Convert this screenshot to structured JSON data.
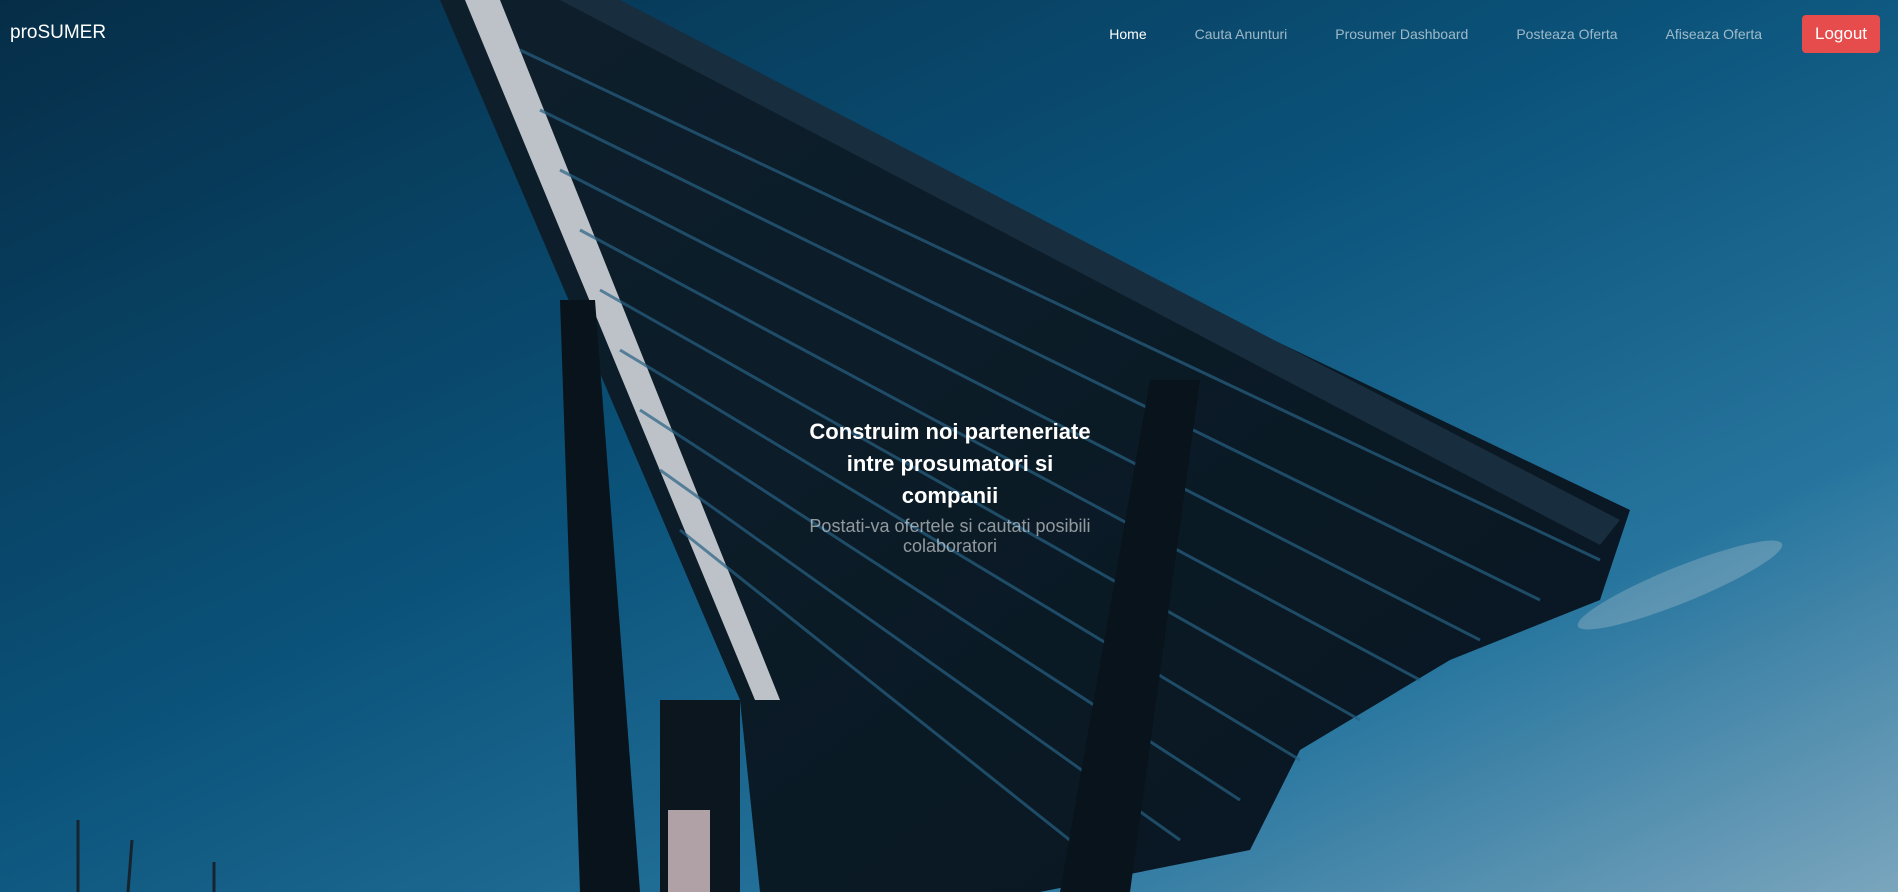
{
  "navbar": {
    "brand": "proSUMER",
    "links": [
      {
        "label": "Home",
        "active": true
      },
      {
        "label": "Cauta Anunturi",
        "active": false
      },
      {
        "label": "Prosumer Dashboard",
        "active": false
      },
      {
        "label": "Posteaza Oferta",
        "active": false
      },
      {
        "label": "Afiseaza Oferta",
        "active": false
      }
    ],
    "logout_label": "Logout"
  },
  "hero": {
    "title": "Construim noi parteneriate intre prosumatori si companii",
    "subtitle": "Postati-va ofertele si cautati posibili colaboratori"
  },
  "colors": {
    "logout_button": "#e74c4c",
    "sky": "#1a78a8",
    "panel_structure": "#0e2332"
  }
}
